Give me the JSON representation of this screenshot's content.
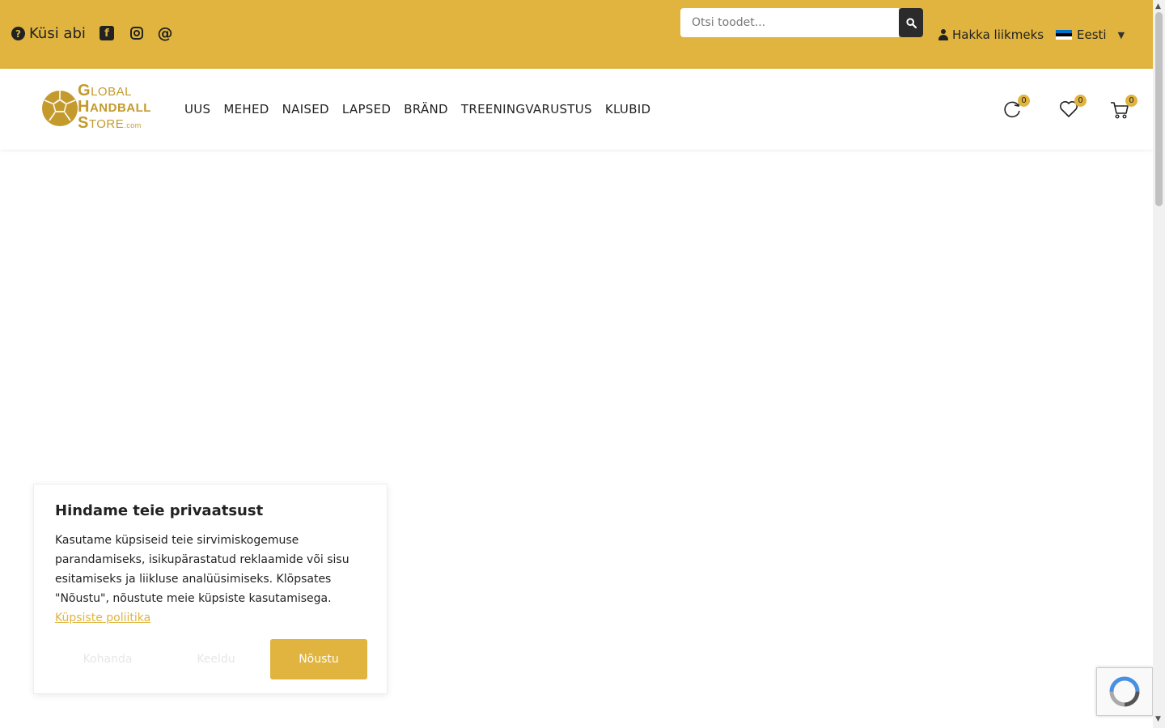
{
  "topbar": {
    "help_label": "Küsi abi",
    "search_placeholder": "Otsi toodet...",
    "account_label": "Hakka liikmeks",
    "language_label": "Eesti",
    "accent_color": "#e0b43e"
  },
  "logo": {
    "line1": "LOBAL",
    "line1_initial": "G",
    "line2": "ANDBALL",
    "line2_initial": "H",
    "line3": "TORE",
    "line3_initial": "S",
    "suffix": ".com"
  },
  "menu": {
    "items": [
      "UUS",
      "MEHED",
      "NAISED",
      "LAPSED",
      "BRÄND",
      "TREENINGVARUSTUS",
      "KLUBID"
    ]
  },
  "header_icons": {
    "compare_count": "0",
    "wishlist_count": "0",
    "cart_count": "0"
  },
  "cookie": {
    "title": "Hindame teie privaatsust",
    "body": "Kasutame küpsiseid teie sirvimiskogemuse parandamiseks, isikupärastatud reklaamide või sisu esitamiseks ja liikluse analüüsimiseks. Klõpsates \"Nõustu\", nõustute meie küpsiste kasutamisega.",
    "policy_link": "Küpsiste poliitika",
    "customize_label": "Kohanda",
    "reject_label": "Keeldu",
    "accept_label": "Nõustu"
  }
}
